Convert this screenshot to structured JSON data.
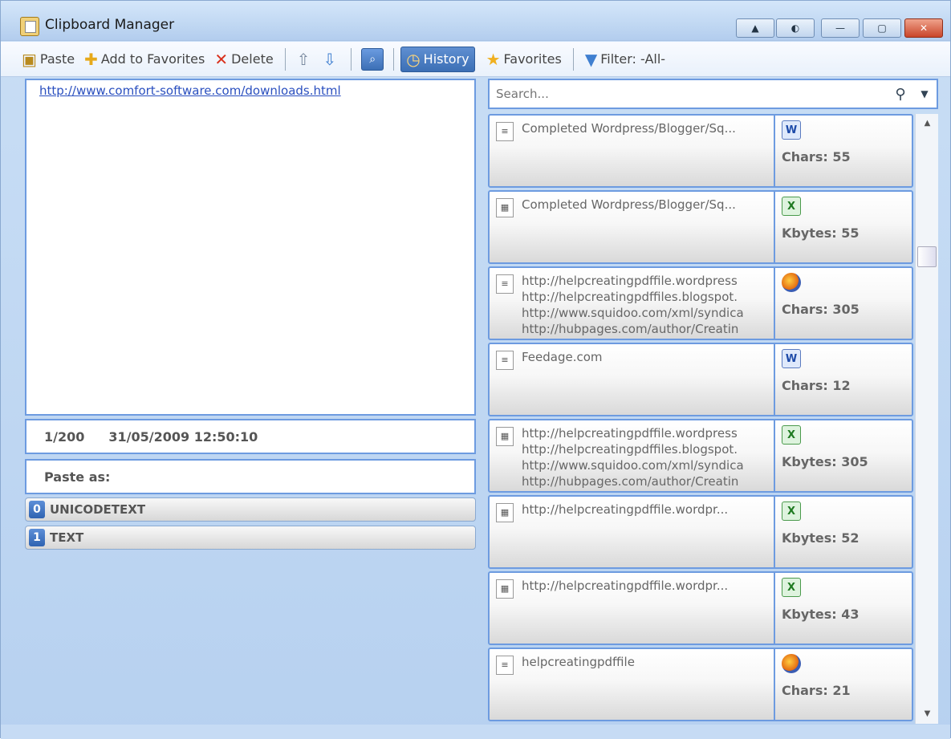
{
  "window": {
    "title": "Clipboard Manager",
    "controls": [
      "▲",
      "◐",
      "—",
      "▢",
      "✕"
    ]
  },
  "toolbar": {
    "paste_label": "Paste",
    "add_favorites_label": "Add to Favorites",
    "delete_label": "Delete",
    "history_label": "History",
    "favorites_label": "Favorites",
    "filter_label": "Filter: -All-"
  },
  "preview": {
    "link": "http://www.comfort-software.com/downloads.html"
  },
  "info": {
    "position": "1/200",
    "timestamp": "31/05/2009 12:50:10"
  },
  "paste_as": {
    "label": "Paste as:",
    "formats": [
      {
        "index": "0",
        "name": "UNICODETEXT"
      },
      {
        "index": "1",
        "name": "TEXT"
      }
    ]
  },
  "search": {
    "placeholder": "Search..."
  },
  "history": [
    {
      "lines": [
        "Completed Wordpress/Blogger/Sq..."
      ],
      "app": "word-icon",
      "app_glyph": "W",
      "meta": "Chars: 55"
    },
    {
      "lines": [
        "Completed Wordpress/Blogger/Sq..."
      ],
      "app": "excel-icon",
      "app_glyph": "X",
      "meta": "Kbytes: 55"
    },
    {
      "lines": [
        "http://helpcreatingpdffile.wordpress",
        "http://helpcreatingpdffiles.blogspot.",
        "http://www.squidoo.com/xml/syndica",
        "http://hubpages.com/author/Creatin"
      ],
      "app": "firefox-icon",
      "app_glyph": "",
      "meta": "Chars: 305"
    },
    {
      "lines": [
        "Feedage.com"
      ],
      "app": "word-icon",
      "app_glyph": "W",
      "meta": "Chars: 12"
    },
    {
      "lines": [
        "http://helpcreatingpdffile.wordpress",
        "http://helpcreatingpdffiles.blogspot.",
        "http://www.squidoo.com/xml/syndica",
        "http://hubpages.com/author/Creatin"
      ],
      "app": "excel-icon",
      "app_glyph": "X",
      "meta": "Kbytes: 305"
    },
    {
      "lines": [
        "http://helpcreatingpdffile.wordpr..."
      ],
      "app": "excel-icon",
      "app_glyph": "X",
      "meta": "Kbytes: 52"
    },
    {
      "lines": [
        "http://helpcreatingpdffile.wordpr..."
      ],
      "app": "excel-icon",
      "app_glyph": "X",
      "meta": "Kbytes: 43"
    },
    {
      "lines": [
        "helpcreatingpdffile"
      ],
      "app": "firefox-icon",
      "app_glyph": "",
      "meta": "Chars: 21"
    }
  ]
}
